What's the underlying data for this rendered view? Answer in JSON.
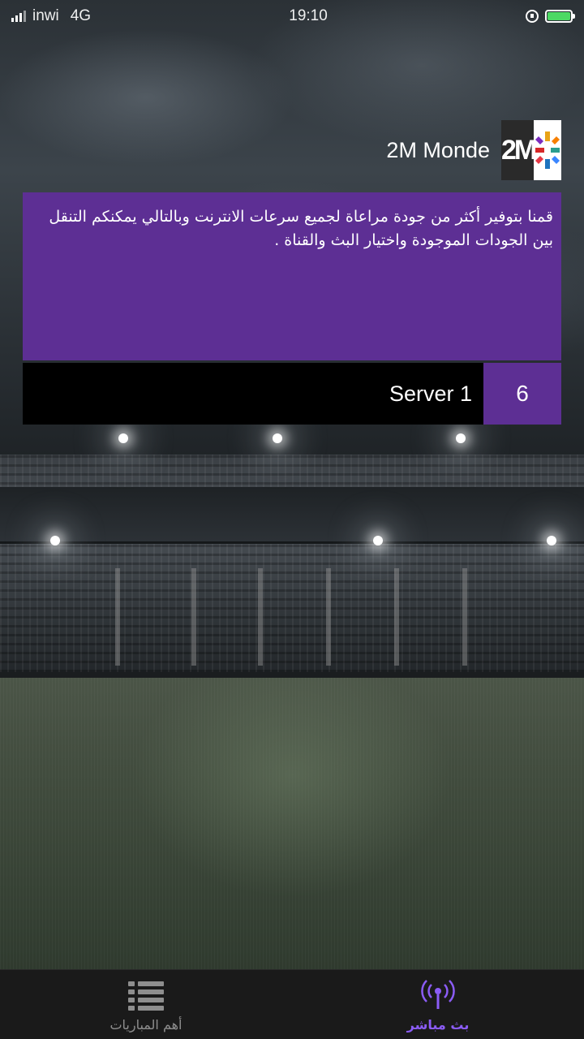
{
  "status_bar": {
    "carrier": "inwi",
    "network": "4G",
    "time": "19:10",
    "battery_color": "#4cd964"
  },
  "channel": {
    "name": "2M Monde",
    "logo_text": "2M",
    "logo_icon": "2m-star-logo-icon"
  },
  "description": {
    "text": "قمنا بتوفير أكثر من جودة مراعاة لجميع سرعات الانترنت وبالتالي يمكنكم التنقل بين الجودات الموجودة واختيار البث والقناة ."
  },
  "server": {
    "label": "Server 1",
    "number": "6"
  },
  "tab_bar": {
    "tabs": [
      {
        "label": "أهم المباريات",
        "icon": "list-icon",
        "active": false
      },
      {
        "label": "بث مباشر",
        "icon": "broadcast-icon",
        "active": true
      }
    ]
  },
  "colors": {
    "accent": "#5d2f94",
    "active_tab": "#8b5cf6",
    "inactive_tab": "#8e8e8e"
  }
}
